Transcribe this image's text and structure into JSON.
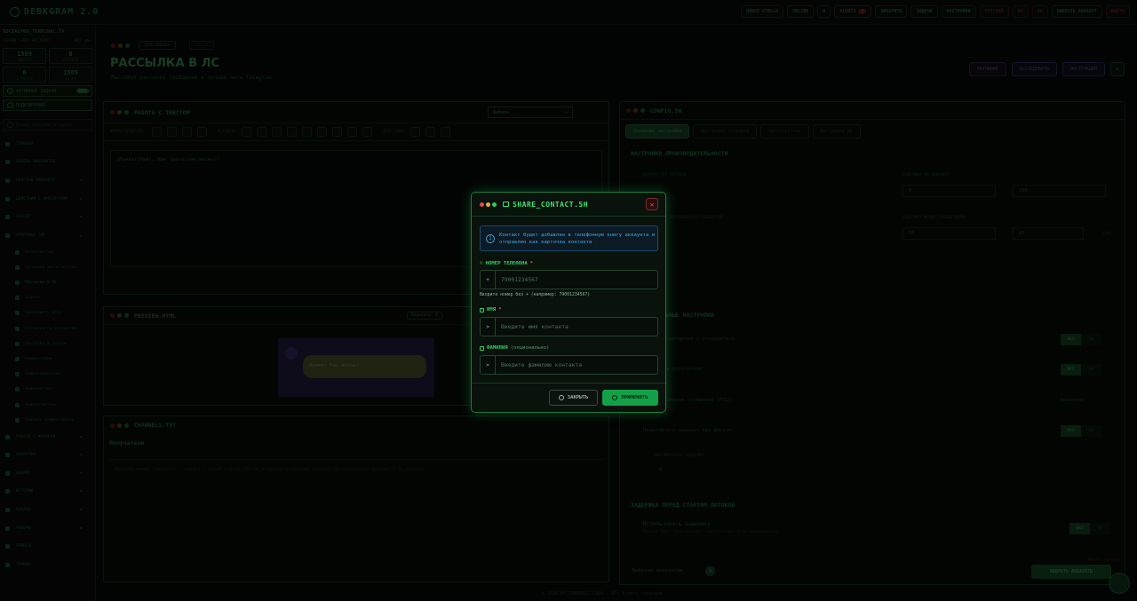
{
  "app": {
    "title": "DEBKGRAM 2.0"
  },
  "topbar": {
    "chips": [
      {
        "label": "ПОИСК",
        "extra": "CTRL+K"
      },
      {
        "label": "ONLINE"
      },
      {
        "label": "0"
      },
      {
        "label": "ALERTS",
        "badge": "1"
      },
      {
        "label": "АККАУНТЫ"
      },
      {
        "label": "ЗАДАЧИ"
      },
      {
        "label": "НАСТРОЙКИ"
      },
      {
        "label": "РУССКИЙ"
      },
      {
        "label": "RU"
      },
      {
        "label": "RU"
      },
      {
        "label": "ВЫБРАТЬ АККАУНТ"
      },
      {
        "label": "ВЫЙТИ"
      }
    ]
  },
  "sidebar": {
    "account_name": "SOCIALPRO_TERMINAL.TX",
    "account_sub_left": "ТАРИФ: PRO ACCOUNT",
    "account_sub_right": "482 дн.",
    "stats": [
      {
        "value": "1589",
        "label": "АККАУНТ"
      },
      {
        "value": "0",
        "label": "ПОТОКОВ"
      },
      {
        "value": "0",
        "label": "В РАБОТЕ"
      },
      {
        "value": "1589",
        "label": "ВСЕГО"
      }
    ],
    "tasks_button": "АКТИВНЫЕ ЗАДАЧИ",
    "tasks_badge": "NEW",
    "second_button": "ПОДКЛЮЧЕНИЕ",
    "search_placeholder": "Поиск модулей и задач",
    "nav": [
      {
        "label": "ГЛАВНАЯ",
        "type": "item"
      },
      {
        "label": "ПАНЕЛЬ АККАУНТОВ",
        "type": "item"
      },
      {
        "label": "ПРОГРЕВ АККАУНТА",
        "type": "group"
      },
      {
        "label": "ДЕЙСТВИЯ С АККАУНТАМИ",
        "type": "group"
      },
      {
        "label": "ПАРСЕР",
        "type": "group"
      },
      {
        "label": "ОТПРАВКА СМС",
        "type": "group-open"
      },
      {
        "label": "Автоответчик",
        "type": "sub"
      },
      {
        "label": "Активный автоответчик",
        "type": "sub"
      },
      {
        "label": "Рассылка в ЛС",
        "type": "sub",
        "active": true
      },
      {
        "label": "Звонки",
        "type": "sub"
      },
      {
        "label": "Предложить фото",
        "type": "sub"
      },
      {
        "label": "Рассылка по контактам",
        "type": "sub"
      },
      {
        "label": "Рассылка в группы",
        "type": "sub"
      },
      {
        "label": "Комментарии",
        "type": "sub"
      },
      {
        "label": "Нейрокомментинг",
        "type": "sub"
      },
      {
        "label": "Нейрочаттинг",
        "type": "sub"
      },
      {
        "label": "Нейроответчик",
        "type": "sub"
      },
      {
        "label": "Лайкинг комментариев",
        "type": "sub"
      },
      {
        "label": "РАБОТА С ЖАЛОБОЙ",
        "type": "group"
      },
      {
        "label": "НАКРУТКА",
        "type": "group"
      },
      {
        "label": "ИНВАЙТ",
        "type": "group"
      },
      {
        "label": "ИСТОРИИ",
        "type": "group"
      },
      {
        "label": "КАНАЛЫ",
        "type": "group"
      },
      {
        "label": "ЧЕКЕРЫ",
        "type": "group"
      },
      {
        "label": "ПРОКСИ",
        "type": "item"
      },
      {
        "label": "ТЕРМИН",
        "type": "item"
      }
    ]
  },
  "header": {
    "pill_a": "SPAM MODULE",
    "pill_b": "run.sh",
    "title": "РАССЫЛКА В ЛС",
    "subtitle": "Массовая рассылка сообщений в личные чаты Telegram",
    "buttons": [
      "ОБУЧЕНИЕ",
      "ИССЛЕДОВАТЬ",
      "ИНСТРУКЦИЯ"
    ]
  },
  "editor": {
    "title": "РАБОТА С ТЕКСТОМ",
    "template_select": "Шаблон ...",
    "tools_label_1": "ФОРМАТИРОВАНИЕ:",
    "tools_label_2": "ВСТАВКА:",
    "tools_label_3": "ДЕЙСТВИЯ:",
    "content": "{Привет|Хай}. Как {дела|сам|жизнь}?"
  },
  "preview": {
    "title": "PREVIEW.HTML",
    "badge": "Варианты: 9",
    "bubble": "Привет Как жизнь?"
  },
  "channels": {
    "title": "CHANNELS.TXT",
    "label": "Получатели",
    "placeholder": "Введите имена (каналов) — каждый с новой строки (После открытия созданные контакт автоматически удаляются из списка)"
  },
  "config": {
    "title": "CONFIG.SH",
    "tabs": [
      "Основные настройки",
      "Настройки отправки",
      "Автоответчик",
      "Настройки AI"
    ],
    "perf_header": "НАСТРОЙКИ ПРОИЗВОДИТЕЛЬНОСТИ",
    "threads_label": "КОЛИЧЕСТВО ПОТОКОВ",
    "delay_label": "ЗАДЕРЖКА НА АККАУНТ:",
    "delay_from": "0",
    "delay_to": "100",
    "msgs_label": "КОЛИЧЕСТВО ОТПРАВЛЕННЫХ СООБЩЕНИЙ:",
    "msgs_delay_label": "ЗАДЕРЖКА МЕЖДУ СООБЩЕНИЯМИ:",
    "msgs_from": "50",
    "msgs_to": "60",
    "unit": "Сек",
    "extra_header": "ДОПОЛНИТЕЛЬНЫЕ НАСТРОЙКИ",
    "options": [
      {
        "label": "Удалять сообщения у отправителя:"
      },
      {
        "label": "Сохранять получателя:"
      },
      {
        "label": "Время удаления сообщений (TTL):",
        "value": "Выключено"
      },
      {
        "label": "Переключить аккаунт при флудах:"
      }
    ],
    "max_delay_label": "МАКСИМАЛЬНАЯ ЗАДЕРЖКА:",
    "max_delay_value": "0",
    "start_header": "ЗАДЕРЖКА ПЕРЕД СТАРТОМ ПОТОКОВ",
    "use_delay_label": "Использовать задержку",
    "use_delay_sub": "Потоки будут запускаться с интервалом, а не одновременно",
    "toggle_on": "ВКЛ",
    "toggle_off": "ВЫ",
    "selected_accounts_label": "Выбрано аккаунтов:",
    "selected_accounts_value": "0",
    "select_accounts_button": "ВЫБРАТЬ АККАУНТЫ",
    "stop_label": "Ждать запуск"
  },
  "footer": {
    "note": "© 2026 BY CHANNELS_CASH — All rights reserved"
  },
  "modal": {
    "title": "SHARE_CONTACT.SH",
    "info": "Контакт будет добавлен в телефонную книгу аккаунта и отправлен как карточка контакта",
    "phone_label": "НОМЕР ТЕЛЕФОНА",
    "phone_prefix": "+",
    "phone_placeholder": "79001234567",
    "phone_hint": "Вводите номер без + (например: 79001234567)",
    "first_label": "ИМЯ",
    "first_prefix": ">",
    "first_placeholder": "Введите имя контакта",
    "last_label": "ФАМИЛИЯ",
    "last_optional": "(опционально)",
    "last_prefix": ">",
    "last_placeholder": "Введите фамилию контакта",
    "required_mark": "*",
    "close_button": "ЗАКРЫТЬ",
    "apply_button": "ПРИМЕНИТЬ"
  },
  "colors": {
    "accent": "#2ecf62",
    "modal_border": "#1e7a3f",
    "info": "#49a7de",
    "danger": "#e24b4b"
  }
}
